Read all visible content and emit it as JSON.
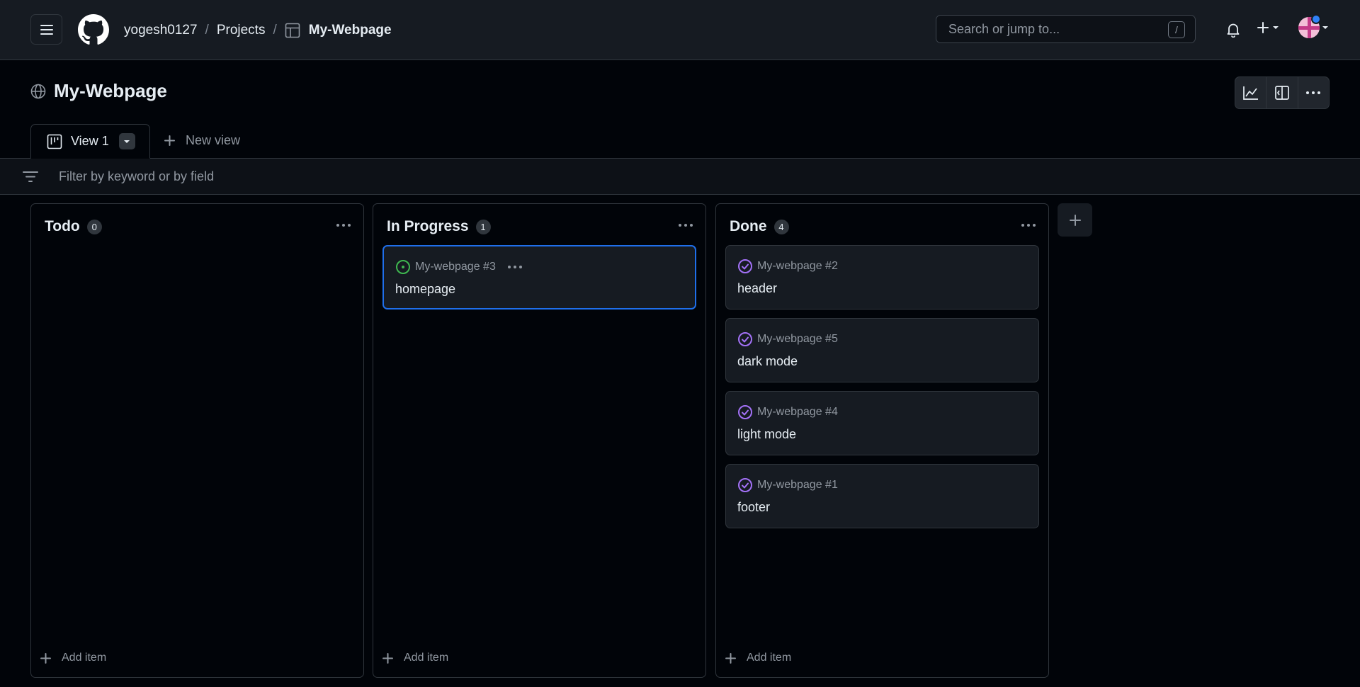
{
  "header": {
    "owner": "yogesh0127",
    "section": "Projects",
    "project": "My-Webpage",
    "separator": "/",
    "search_placeholder": "Search or jump to...",
    "search_shortcut": "/"
  },
  "project": {
    "title": "My-Webpage",
    "actions": [
      "insights-icon",
      "side-panel-icon",
      "kebab-horizontal-icon"
    ]
  },
  "views": {
    "active_tab": "View 1",
    "new_view_label": "New view"
  },
  "filter": {
    "placeholder": "Filter by keyword or by field"
  },
  "board": {
    "add_item_label": "Add item",
    "columns": [
      {
        "title": "Todo",
        "count": "0",
        "cards": []
      },
      {
        "title": "In Progress",
        "count": "1",
        "cards": [
          {
            "ref": "My-webpage #3",
            "title": "homepage",
            "status": "open"
          }
        ]
      },
      {
        "title": "Done",
        "count": "4",
        "cards": [
          {
            "ref": "My-webpage #2",
            "title": "header",
            "status": "completed"
          },
          {
            "ref": "My-webpage #5",
            "title": "dark mode",
            "status": "completed"
          },
          {
            "ref": "My-webpage #4",
            "title": "light mode",
            "status": "completed"
          },
          {
            "ref": "My-webpage #1",
            "title": "footer",
            "status": "completed"
          }
        ]
      }
    ]
  },
  "colors": {
    "open_issue": "#3fb950",
    "completed_issue": "#a371f7",
    "selected_border": "#1f6feb",
    "notification_dot": "#2f81f7"
  }
}
